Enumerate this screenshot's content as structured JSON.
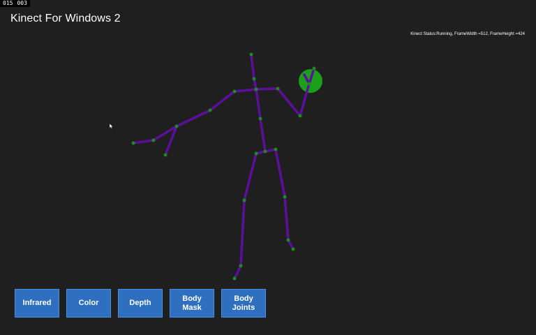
{
  "frame_counter": {
    "left": "015",
    "right": "003"
  },
  "app": {
    "title": "Kinect For Windows 2"
  },
  "status": {
    "text": "Kinect Status:Running, FrameWidth =512, FrameHeight =424"
  },
  "skeleton": {
    "bone_color": "#5b0f9c",
    "joint_color": "#1f8a1f",
    "hand_state_color": "#1aa01a"
  },
  "buttons": [
    {
      "name": "infrared-button",
      "label": "Infrared"
    },
    {
      "name": "color-button",
      "label": "Color"
    },
    {
      "name": "depth-button",
      "label": "Depth"
    },
    {
      "name": "body-mask-button",
      "label": "Body\nMask"
    },
    {
      "name": "body-joints-button",
      "label": "Body\nJoints"
    }
  ]
}
